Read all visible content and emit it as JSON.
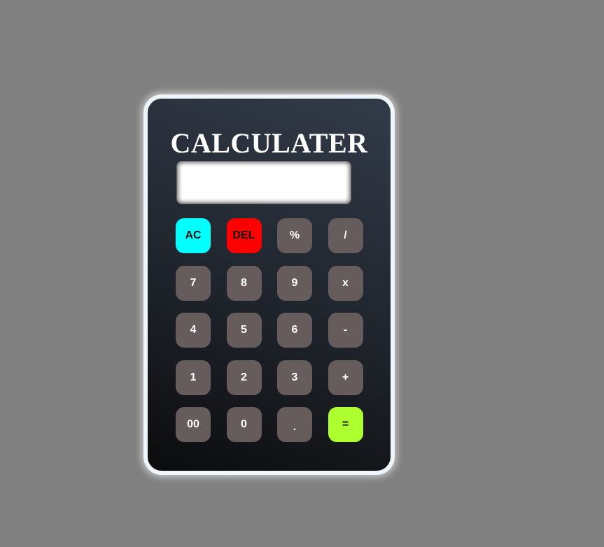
{
  "title": "CALCULATER",
  "display": {
    "value": ""
  },
  "buttons": [
    [
      "AC",
      "DEL",
      "%",
      "/"
    ],
    [
      "7",
      "8",
      "9",
      "x"
    ],
    [
      "4",
      "5",
      "6",
      "-"
    ],
    [
      "1",
      "2",
      "3",
      "+"
    ],
    [
      "00",
      "0",
      ".",
      "="
    ]
  ],
  "colors": {
    "background": "#808080",
    "key": "#665c5c",
    "ac": "#00ffff",
    "del": "#ff0000",
    "equals": "#adff2f"
  }
}
